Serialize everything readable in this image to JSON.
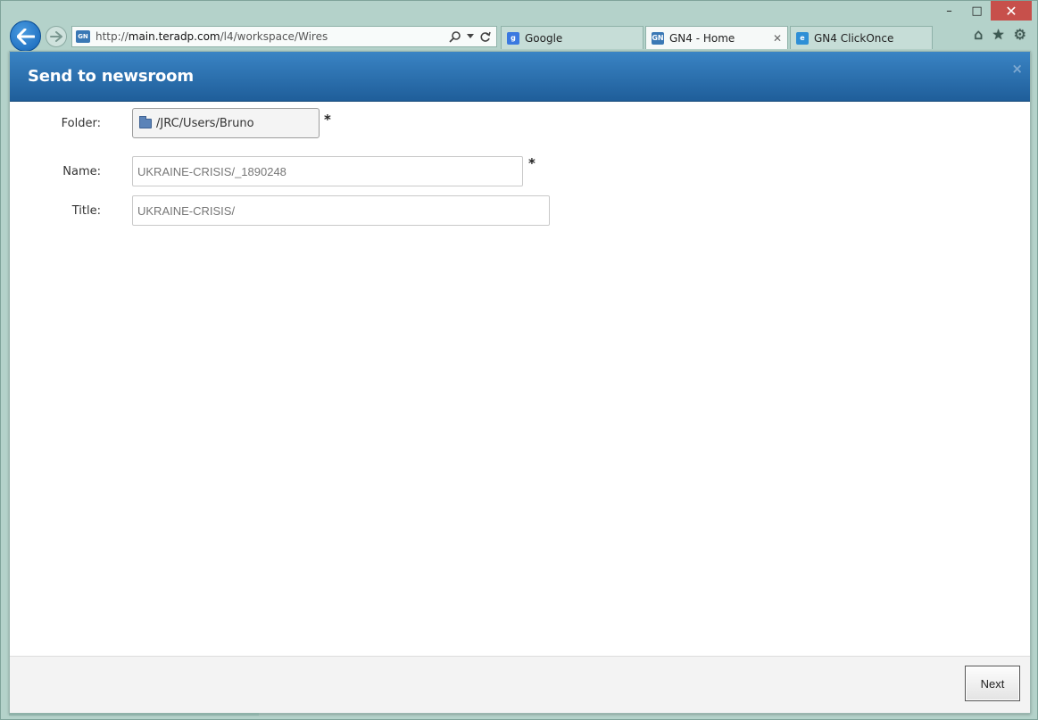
{
  "browser": {
    "url": "http://main.teradp.com/l4/workspace/Wires",
    "url_host": "main.teradp.com",
    "site_icon": "GN",
    "tabs": [
      {
        "label": "Google",
        "icon": "google-favicon",
        "active": false
      },
      {
        "label": "GN4 - Home",
        "icon": "gn4-favicon",
        "active": true
      },
      {
        "label": "GN4 ClickOnce",
        "icon": "ie-favicon",
        "active": false
      }
    ],
    "window_buttons": {
      "minimize": "–",
      "maximize": "□",
      "close": "✕"
    },
    "tools": {
      "home": "⌂",
      "favorites": "★",
      "settings": "⚙"
    }
  },
  "dialog": {
    "title": "Send to newsroom",
    "close_glyph": "×",
    "fields": {
      "folder": {
        "label": "Folder:",
        "value": "/JRC/Users/Bruno",
        "required_mark": "*"
      },
      "name": {
        "label": "Name:",
        "value": "UKRAINE-CRISIS/_1890248",
        "required_mark": "*"
      },
      "title": {
        "label": "Title:",
        "value": "UKRAINE-CRISIS/"
      }
    },
    "footer": {
      "next_label": "Next"
    }
  }
}
